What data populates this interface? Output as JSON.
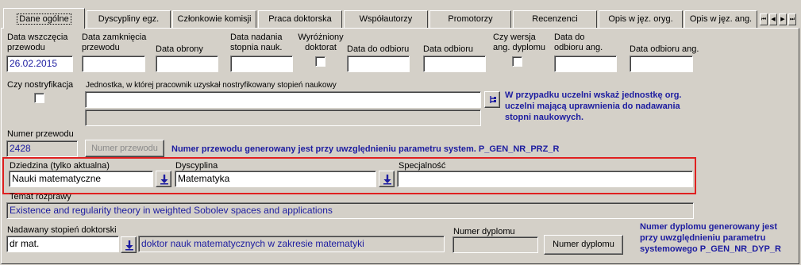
{
  "tabs": [
    {
      "label": "Dane ogólne",
      "active": true
    },
    {
      "label": "Dyscypliny egz."
    },
    {
      "label": "Członkowie komisji"
    },
    {
      "label": "Praca doktorska"
    },
    {
      "label": "Współautorzy"
    },
    {
      "label": "Promotorzy"
    },
    {
      "label": "Recenzenci"
    },
    {
      "label": "Opis w jęz. oryg."
    },
    {
      "label": "Opis w jęz. ang."
    }
  ],
  "tab_nav": {
    "first": "⏮",
    "prev": "◀",
    "next": "▶",
    "last": "⏭"
  },
  "fields": {
    "data_wszczecia": {
      "label": "Data wszczęcia przewodu",
      "value": "26.02.2015"
    },
    "data_zamkniecia": {
      "label": "Data zamknięcia przewodu",
      "value": ""
    },
    "data_obrony": {
      "label": "Data obrony",
      "value": ""
    },
    "data_nadania": {
      "label": "Data nadania stopnia nauk.",
      "value": ""
    },
    "wyrozniony": {
      "label": "Wyróżniony doktorat",
      "checked": false
    },
    "data_do_odbioru": {
      "label": "Data do odbioru",
      "value": ""
    },
    "data_odbioru": {
      "label": "Data odbioru",
      "value": ""
    },
    "czy_wersja_ang": {
      "label": "Czy wersja ang. dyplomu",
      "checked": false
    },
    "data_do_odbioru_ang": {
      "label": "Data do odbioru ang.",
      "value": ""
    },
    "data_odbioru_ang": {
      "label": "Data odbioru ang.",
      "value": ""
    },
    "czy_nostryfikacja": {
      "label": "Czy nostryfikacja",
      "checked": false
    },
    "jednostka": {
      "label": "Jednostka, w której pracownik uzyskał nostryfikowany stopień naukowy",
      "value": "",
      "value2": ""
    },
    "numer_przewodu": {
      "label": "Numer przewodu",
      "value": "2428",
      "button": "Numer przewodu"
    },
    "dziedzina": {
      "label": "Dziedzina (tylko aktualna)",
      "value": "Nauki matematyczne"
    },
    "dyscyplina": {
      "label": "Dyscyplina",
      "value": "Matematyka"
    },
    "specjalnosc": {
      "label": "Specjalność",
      "value": ""
    },
    "temat": {
      "label": "Temat rozprawy",
      "value": "Existence and regularity theory in weighted Sobolev spaces and applications"
    },
    "stopien": {
      "label": "Nadawany stopień doktorski",
      "value": "dr mat.",
      "description": "doktor nauk matematycznych w zakresie matematyki"
    },
    "numer_dyplomu": {
      "label": "Numer dyplomu",
      "value": "",
      "button": "Numer dyplomu"
    }
  },
  "notes": {
    "jednostka": "W przypadku uczelni wskaż jednostkę org. uczelni mającą uprawnienia do nadawania stopni naukowych.",
    "numer_przewodu": "Numer przewodu generowany jest przy uwzględnieniu parametru system. P_GEN_NR_PRZ_R",
    "numer_dyplomu": "Numer dyplomu generowany jest przy uwzględnieniu parametru systemowego  P_GEN_NR_DYP_R"
  },
  "colors": {
    "accent_text": "#1c1ca0",
    "highlight": "#e02020",
    "window_bg": "#d4d0c8"
  }
}
